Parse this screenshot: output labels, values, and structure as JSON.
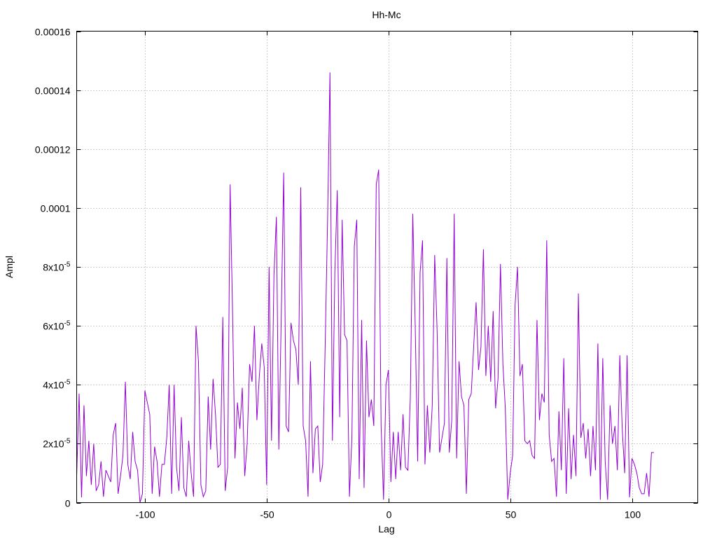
{
  "chart_data": {
    "type": "line",
    "title": "Hh-Mc",
    "xlabel": "Lag",
    "ylabel": "Ampl",
    "xlim": [
      -128,
      127
    ],
    "ylim": [
      0,
      0.00016
    ],
    "grid": true,
    "legend": "none",
    "x_ticks": [
      {
        "value": -100,
        "label": "-100"
      },
      {
        "value": -50,
        "label": "-50"
      },
      {
        "value": 0,
        "label": "0"
      },
      {
        "value": 50,
        "label": "50"
      },
      {
        "value": 100,
        "label": "100"
      }
    ],
    "y_ticks": [
      {
        "value": 0,
        "label": "0",
        "sup": ""
      },
      {
        "value": 2e-05,
        "label": "2x10",
        "sup": "-5"
      },
      {
        "value": 4e-05,
        "label": "4x10",
        "sup": "-5"
      },
      {
        "value": 6e-05,
        "label": "6x10",
        "sup": "-5"
      },
      {
        "value": 8e-05,
        "label": "8x10",
        "sup": "-5"
      },
      {
        "value": 0.0001,
        "label": "0.0001",
        "sup": ""
      },
      {
        "value": 0.00012,
        "label": "0.00012",
        "sup": ""
      },
      {
        "value": 0.00014,
        "label": "0.00014",
        "sup": ""
      },
      {
        "value": 0.00016,
        "label": "0.00016",
        "sup": ""
      }
    ],
    "series": [
      {
        "color": "#9400d3",
        "x_start": -128,
        "x_step": 1,
        "values": [
          9e-06,
          3.7e-05,
          1.8e-06,
          3.3e-05,
          9e-06,
          2.1e-05,
          6e-06,
          2e-05,
          4e-06,
          6e-06,
          1.4e-05,
          2e-06,
          1.1e-05,
          9e-06,
          7e-06,
          2.3e-05,
          2.7e-05,
          3e-06,
          9e-06,
          1.6e-05,
          4.1e-05,
          1.3e-05,
          8e-06,
          2.4e-05,
          1.4e-05,
          1.1e-05,
          0,
          3e-06,
          3.8e-05,
          3.4e-05,
          3e-05,
          3e-06,
          1.9e-05,
          1.4e-05,
          2e-06,
          1.3e-05,
          1.3e-05,
          2.2e-05,
          4e-05,
          3e-06,
          4e-05,
          1.2e-05,
          4e-06,
          2.9e-05,
          5e-06,
          2e-06,
          2.1e-05,
          1e-05,
          2e-06,
          6e-05,
          4.8e-05,
          6e-06,
          2e-06,
          4e-06,
          3.6e-05,
          1.8e-05,
          4.2e-05,
          3e-05,
          1.2e-05,
          1.3e-05,
          6.3e-05,
          4e-06,
          1.2e-05,
          0.000108,
          6.5e-05,
          1.5e-05,
          3.4e-05,
          2.5e-05,
          3.9e-05,
          9e-06,
          2e-05,
          4.7e-05,
          4.1e-05,
          6e-05,
          2.8e-05,
          4.3e-05,
          5.4e-05,
          4.6e-05,
          6e-06,
          8e-05,
          2.1e-05,
          7.7e-05,
          9.7e-05,
          1.8e-05,
          6.3e-05,
          0.000112,
          2.6e-05,
          2.4e-05,
          6.1e-05,
          5.5e-05,
          5.2e-05,
          4e-05,
          0.000107,
          2.6e-05,
          2.1e-05,
          2e-06,
          4.8e-05,
          1e-05,
          2.5e-05,
          2.6e-05,
          7e-06,
          1.3e-05,
          5.2e-05,
          9.5e-05,
          0.000146,
          2.1e-05,
          7.8e-05,
          0.000106,
          2.9e-05,
          9.6e-05,
          5.7e-05,
          5.5e-05,
          2e-06,
          2.2e-05,
          8.7e-05,
          9.6e-05,
          8e-06,
          6.2e-05,
          5e-06,
          5.5e-05,
          2.9e-05,
          3.5e-05,
          2.6e-05,
          0.000108,
          0.000113,
          2.6e-05,
          1e-06,
          4e-05,
          4.5e-05,
          7e-06,
          2.4e-05,
          8e-06,
          2.4e-05,
          1.1e-05,
          3e-05,
          1.2e-05,
          1.1e-05,
          3.6e-05,
          9.8e-05,
          6e-05,
          1.4e-05,
          7.8e-05,
          8.9e-05,
          1.3e-05,
          3.3e-05,
          1.7e-05,
          3.3e-05,
          8.4e-05,
          5.8e-05,
          1.7e-05,
          2.2e-05,
          2.7e-05,
          8.3e-05,
          1.7e-05,
          2.8e-05,
          9.8e-05,
          1.5e-05,
          4.8e-05,
          3.6e-05,
          3.3e-05,
          3e-06,
          3.5e-05,
          3.7e-05,
          5.3e-05,
          6.8e-05,
          4.5e-05,
          5.3e-05,
          8.6e-05,
          4.3e-05,
          6e-05,
          4.1e-05,
          6.5e-05,
          3.2e-05,
          4.2e-05,
          8.1e-05,
          4.7e-05,
          3.2e-05,
          1e-06,
          1e-05,
          1.6e-05,
          6.7e-05,
          8e-05,
          4.3e-05,
          4.7e-05,
          2.1e-05,
          2e-05,
          2.1e-05,
          1.6e-05,
          1.5e-05,
          6.2e-05,
          2.8e-05,
          3.7e-05,
          3.4e-05,
          8.9e-05,
          2.3e-05,
          1.4e-05,
          1.5e-05,
          2e-06,
          3.1e-05,
          1.1e-05,
          4.9e-05,
          3e-06,
          3.2e-05,
          8e-06,
          2.3e-05,
          9e-06,
          7.1e-05,
          2.2e-05,
          2.7e-05,
          1.5e-05,
          2.5e-05,
          9e-06,
          2.6e-05,
          1.1e-05,
          5.4e-05,
          1e-06,
          4.9e-05,
          1.4e-05,
          1e-06,
          3.3e-05,
          2e-05,
          2.6e-05,
          1.1e-05,
          5e-05,
          2.5e-05,
          1e-05,
          5e-05,
          1.8e-06,
          1.5e-05,
          1.3e-05,
          1e-05,
          5e-06,
          3e-06,
          3e-06,
          1e-05,
          2e-06,
          1.7e-05,
          1.7e-05
        ]
      }
    ]
  }
}
